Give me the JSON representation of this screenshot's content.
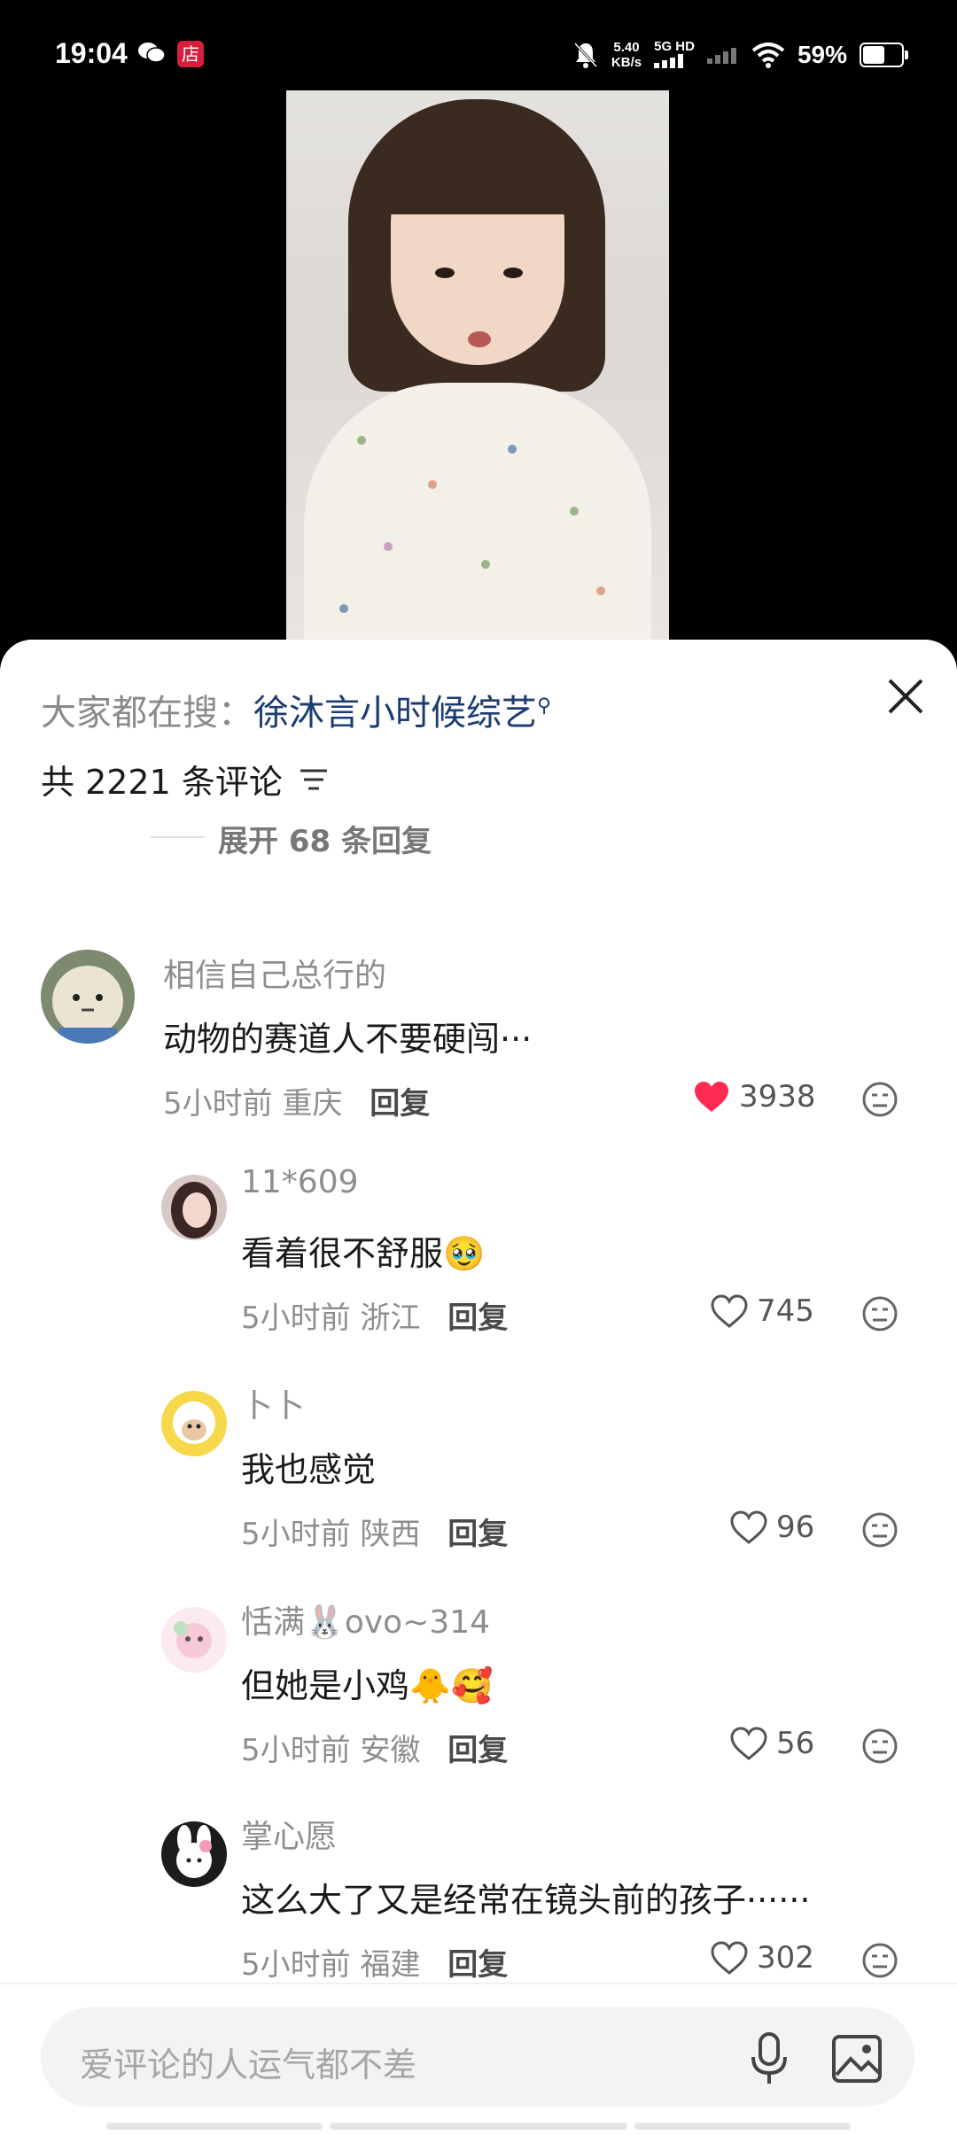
{
  "status_bar": {
    "time": "19:04",
    "shop_badge": "店",
    "speed_value": "5.40",
    "speed_unit": "KB/s",
    "network": "5G HD",
    "battery_percent": "59%",
    "battery_level": 0.59
  },
  "comments_sheet": {
    "search_prefix": "大家都在搜：",
    "search_term": "徐沐言小时候综艺",
    "total_label": "共 2221 条评论",
    "expand_replies": "展开 68 条回复",
    "comments": [
      {
        "user": "相信自己总行的",
        "text": "动物的赛道人不要硬闯···",
        "time": "5小时前",
        "location": "重庆",
        "reply_label": "回复",
        "likes": "3938",
        "liked": true
      },
      {
        "user": "11*609",
        "text": "看着很不舒服🥹",
        "time": "5小时前",
        "location": "浙江",
        "reply_label": "回复",
        "likes": "745",
        "liked": false
      },
      {
        "user": "卜卜",
        "text": "我也感觉",
        "time": "5小时前",
        "location": "陕西",
        "reply_label": "回复",
        "likes": "96",
        "liked": false
      },
      {
        "user": "恬满🐰ovo~314",
        "text": "但她是小鸡🐥🥰",
        "time": "5小时前",
        "location": "安徽",
        "reply_label": "回复",
        "likes": "56",
        "liked": false
      },
      {
        "user": "掌心愿",
        "text": "这么大了又是经常在镜头前的孩子······",
        "time": "5小时前",
        "location": "福建",
        "reply_label": "回复",
        "likes": "302",
        "liked": false
      }
    ]
  },
  "input": {
    "placeholder": "爱评论的人运气都不差"
  },
  "colors": {
    "like_red": "#fe2c55",
    "search_blue": "#1c3c73"
  }
}
